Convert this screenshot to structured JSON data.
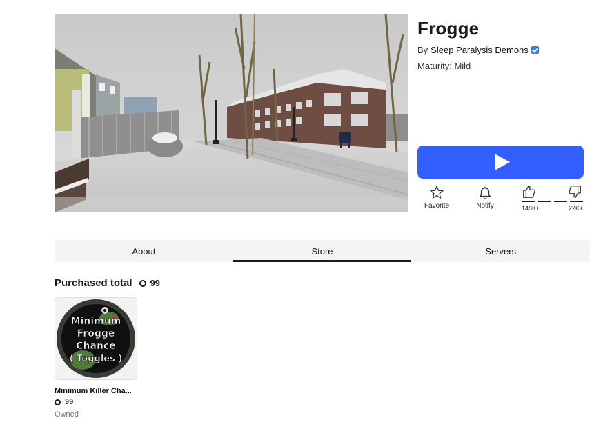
{
  "game": {
    "title": "Frogge",
    "by_label": "By",
    "creator": "Sleep Paralysis Demons",
    "maturity": "Maturity: Mild"
  },
  "actions": {
    "favorite_label": "Favorite",
    "notify_label": "Notify",
    "likes": "148K+",
    "dislikes": "22K+"
  },
  "tabs": [
    {
      "label": "About",
      "active": false
    },
    {
      "label": "Store",
      "active": true
    },
    {
      "label": "Servers",
      "active": false
    }
  ],
  "store": {
    "purchased_label": "Purchased total",
    "purchased_amount": "99",
    "items": [
      {
        "thumb_text": [
          "Minimum",
          "Frogge",
          "Chance",
          "( Toggles )"
        ],
        "name": "Minimum Killer Cha...",
        "price": "99",
        "status": "Owned"
      }
    ]
  },
  "colors": {
    "play_button": "#335fff",
    "verified_badge": "#3a7de8",
    "tab_background": "#f4f4f5",
    "active_tab_underline": "#1a1a1a"
  },
  "icons": {
    "play": "play-icon",
    "favorite": "star-icon",
    "notify": "bell-icon",
    "like": "thumbs-up-icon",
    "dislike": "thumbs-down-icon",
    "currency": "robux-icon",
    "verified": "verified-badge-icon"
  }
}
